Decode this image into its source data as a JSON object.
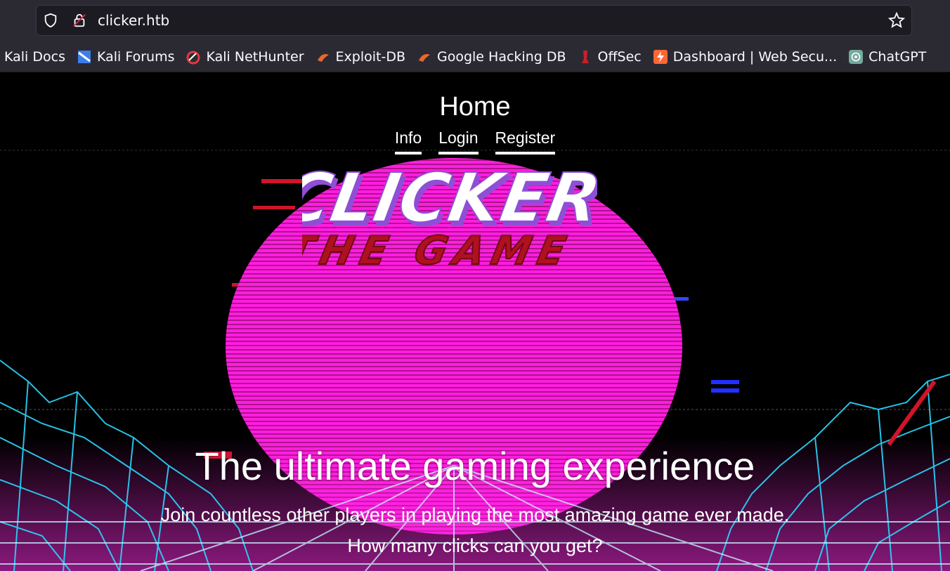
{
  "browser": {
    "url": "clicker.htb",
    "bookmarks": [
      {
        "label": "Kali Docs",
        "icon": "kali-docs-icon"
      },
      {
        "label": "Kali Forums",
        "icon": "kali-forums-icon"
      },
      {
        "label": "Kali NetHunter",
        "icon": "kali-nethunter-icon"
      },
      {
        "label": "Exploit-DB",
        "icon": "exploit-db-icon"
      },
      {
        "label": "Google Hacking DB",
        "icon": "ghdb-icon"
      },
      {
        "label": "OffSec",
        "icon": "offsec-icon"
      },
      {
        "label": "Dashboard | Web Secu...",
        "icon": "portswigger-icon"
      },
      {
        "label": "ChatGPT",
        "icon": "chatgpt-icon"
      }
    ]
  },
  "site": {
    "nav_title": "Home",
    "nav_links": [
      "Info",
      "Login",
      "Register"
    ],
    "logo_text": "CLICKER",
    "logo_subtext": "THE GAME",
    "headline": "The ultimate gaming experience",
    "subheadline": "Join countless other players in playing the most amazing game ever made. How many clicks can you get?"
  },
  "colors": {
    "sun": "#ff1ee0",
    "grid": "#2ad7ff",
    "logo_red": "#c4121a",
    "logo_purple": "#8e4fd6"
  }
}
